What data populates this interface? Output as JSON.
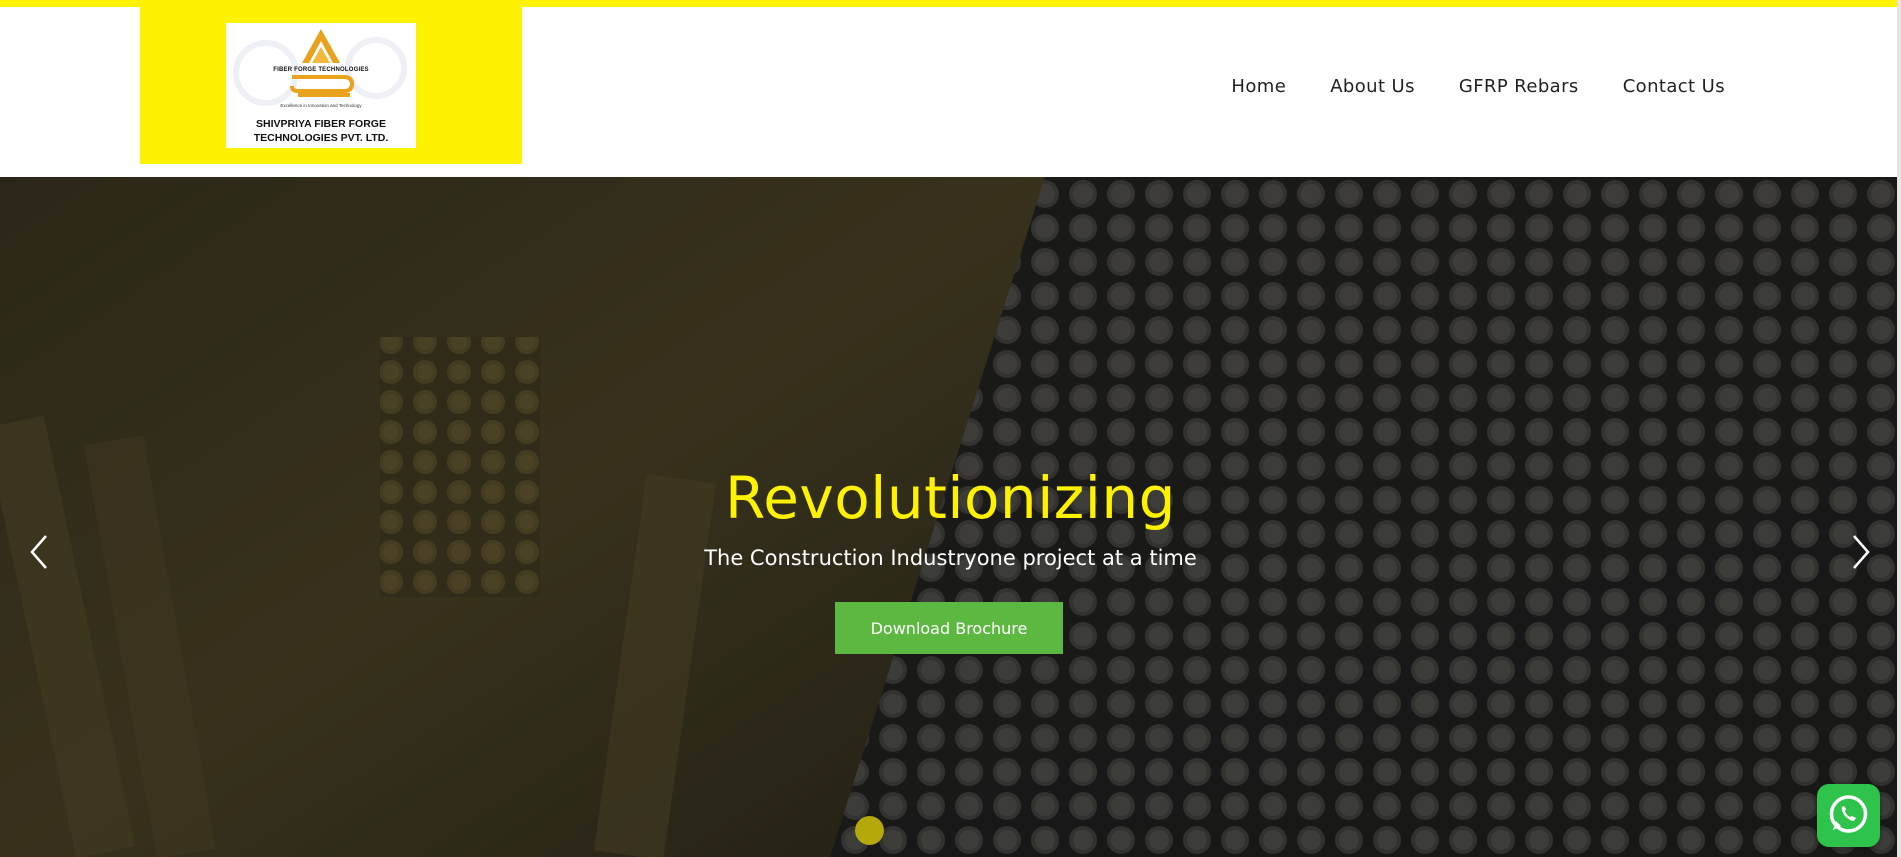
{
  "brand": {
    "logo_tagline_top": "FIBER FORGE TECHNOLOGIES",
    "logo_tagline_small": "Excellence in Innovation and Technology",
    "company_name": "SHIVPRIYA FIBER FORGE TECHNOLOGIES PVT. LTD.",
    "accent_color": "#fff200"
  },
  "nav": {
    "items": [
      {
        "label": "Home"
      },
      {
        "label": "About Us"
      },
      {
        "label": "GFRP Rebars"
      },
      {
        "label": "Contact Us"
      }
    ]
  },
  "hero": {
    "title": "Revolutionizing",
    "subtitle": "The Construction Industryone project at a time",
    "cta_label": "Download Brochure",
    "cta_color": "#5cb840",
    "prev_icon": "chevron-left-icon",
    "next_icon": "chevron-right-icon",
    "slides_count": 1,
    "active_slide": 1
  },
  "floating": {
    "whatsapp_icon": "whatsapp-icon"
  }
}
